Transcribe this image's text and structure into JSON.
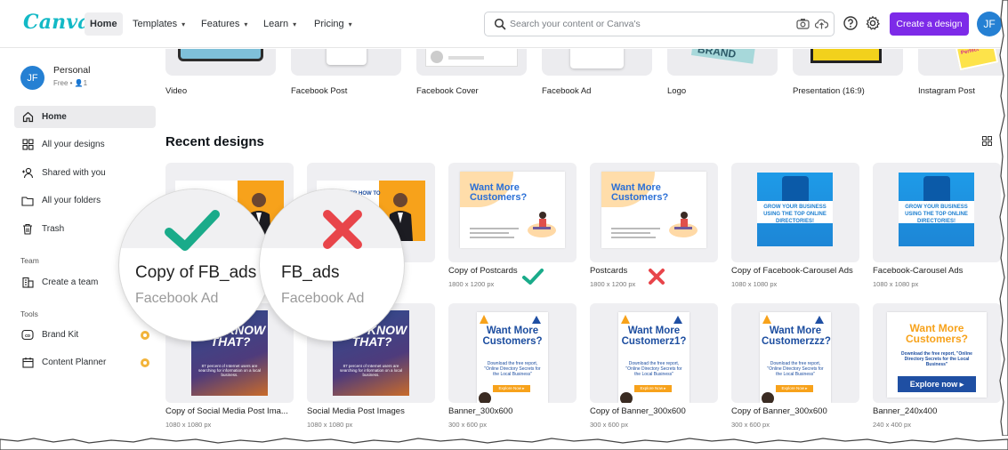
{
  "header": {
    "logo": "Canva",
    "nav": [
      {
        "label": "Home",
        "active": true
      },
      {
        "label": "Templates",
        "chevron": true
      },
      {
        "label": "Features",
        "chevron": true
      },
      {
        "label": "Learn",
        "chevron": true
      },
      {
        "label": "Pricing",
        "chevron": true
      }
    ],
    "search_placeholder": "Search your content or Canva's",
    "create_button": "Create a design",
    "avatar_initials": "JF"
  },
  "account": {
    "initials": "JF",
    "name": "Personal",
    "meta": "Free • 👤1"
  },
  "sidebar": {
    "items": [
      {
        "label": "Home",
        "icon": "home-icon",
        "active": true
      },
      {
        "label": "All your designs",
        "icon": "grid-icon"
      },
      {
        "label": "Shared with you",
        "icon": "users-icon"
      },
      {
        "label": "All your folders",
        "icon": "folder-icon"
      },
      {
        "label": "Trash",
        "icon": "trash-icon"
      }
    ],
    "team_heading": "Team",
    "team_items": [
      {
        "label": "Create a team",
        "icon": "building-icon"
      }
    ],
    "tools_heading": "Tools",
    "tools_items": [
      {
        "label": "Brand Kit",
        "icon": "brand-kit-icon",
        "badge": true
      },
      {
        "label": "Content Planner",
        "icon": "calendar-icon",
        "badge": true
      }
    ]
  },
  "templates": [
    {
      "label": "Video"
    },
    {
      "label": "Facebook Post"
    },
    {
      "label": "Facebook Cover"
    },
    {
      "label": "Facebook Ad"
    },
    {
      "label": "Logo"
    },
    {
      "label": "Presentation (16:9)"
    },
    {
      "label": "Instagram Post"
    }
  ],
  "recent": {
    "title": "Recent designs",
    "row1": [
      {
        "title": "",
        "meta": "",
        "art": "fbad-hidden"
      },
      {
        "title": "",
        "meta": "",
        "art": "fbad-discover"
      },
      {
        "title": "Copy of Postcards",
        "meta": "1800 x 1200 px",
        "art_headline": "Want More Customers?",
        "mark": "check"
      },
      {
        "title": "Postcards",
        "meta": "1800 x 1200 px",
        "art_headline": "Want More Customers?",
        "mark": "cross"
      },
      {
        "title": "Copy of Facebook-Carousel Ads",
        "meta": "1080 x 1080 px",
        "art_text": "GROW YOUR BUSINESS USING THE TOP ONLINE DIRECTORIES!"
      },
      {
        "title": "Facebook-Carousel Ads",
        "meta": "1080 x 1080 px",
        "art_text": "GROW YOUR BUSINESS USING THE TOP ONLINE DIRECTORIES!"
      }
    ],
    "row2": [
      {
        "title": "Copy of Social Media Post Ima...",
        "meta": "1080 x 1080 px",
        "art_headline": "YOU KNOW THAT?"
      },
      {
        "title": "Social Media Post Images",
        "meta": "1080 x 1080 px",
        "art_headline": "YOU KNOW THAT?"
      },
      {
        "title": "Banner_300x600",
        "meta": "300 x 600 px",
        "art_headline": "Want More Customers?",
        "art_sub": "Download the free report, \"Online Directory Secrets for the Local Business\"",
        "art_btn": "Explore Now ▸"
      },
      {
        "title": "Copy of Banner_300x600",
        "meta": "300 x 600 px",
        "art_headline": "Want More Customerz1?",
        "art_sub": "Download the free report, \"Online Directory Secrets for the Local Business\"",
        "art_btn": "Explore Now ▸"
      },
      {
        "title": "Copy of Banner_300x600",
        "meta": "300 x 600 px",
        "art_headline": "Want More Customerzzz?",
        "art_sub": "Download the free report, \"Online Directory Secrets for the Local Business\"",
        "art_btn": "Explore Now ▸"
      },
      {
        "title": "Banner_240x400",
        "meta": "240 x 400 px",
        "art_headline": "Want More Customers?",
        "art_sub": "Download the free report, \"Online Directory Secrets for the Local Business\"",
        "art_btn": "Explore now ▸"
      }
    ]
  },
  "magnifiers": [
    {
      "title": "Copy of FB_ads",
      "subtitle": "Facebook Ad",
      "mark": "check"
    },
    {
      "title": "FB_ads",
      "subtitle": "Facebook Ad",
      "mark": "cross"
    }
  ],
  "colors": {
    "brand": "#13b9c6",
    "accent": "#7d2ae8",
    "check": "#1aab8a",
    "cross": "#e8454a"
  }
}
